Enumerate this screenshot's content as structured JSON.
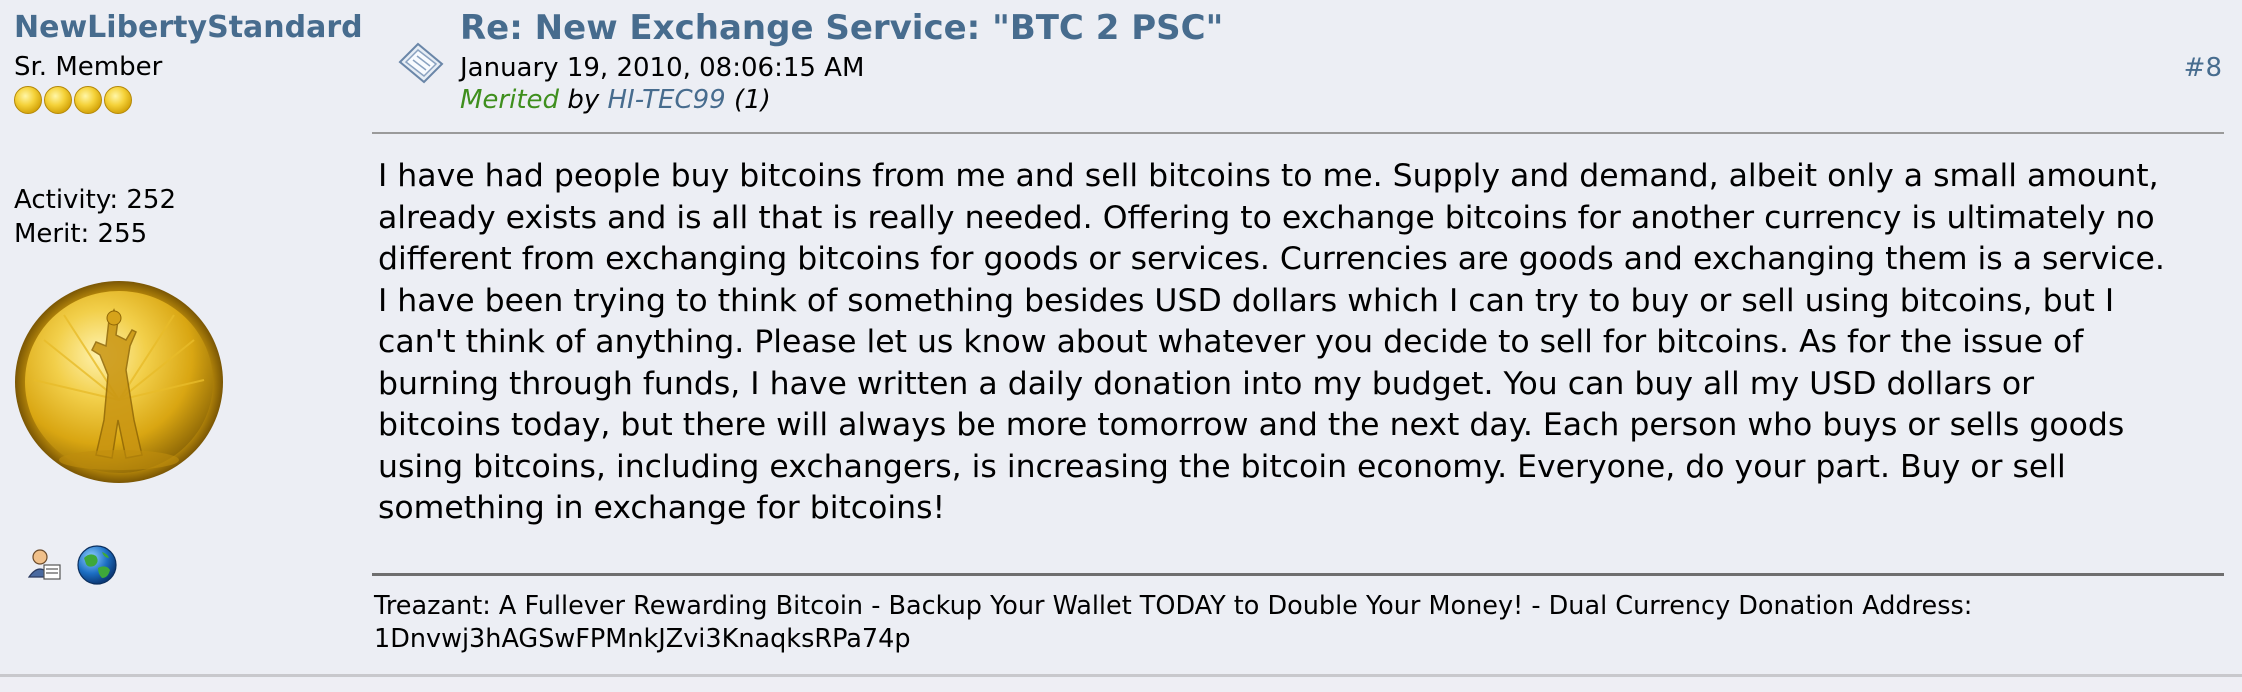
{
  "poster": {
    "name": "NewLibertyStandard",
    "rank": "Sr. Member",
    "star_count": 4,
    "activity": "Activity: 252",
    "merit": "Merit: 255",
    "avatar_icon": "gold-coin-lady-liberty",
    "profile_icons": [
      "profile-icon",
      "website-globe-icon"
    ]
  },
  "post": {
    "subject": "Re: New Exchange Service: \"BTC 2 PSC\"",
    "date": "January 19, 2010, 08:06:15 AM",
    "merited_word": "Merited",
    "merited_by": "by",
    "merited_user": "HI-TEC99",
    "merited_count": "(1)",
    "post_number": "#8",
    "body_lines": [
      "I have had people buy bitcoins from me and sell bitcoins to me. Supply and demand, albeit only a small amount,",
      "already exists and is all that is really needed. Offering to exchange bitcoins for another currency is ultimately no",
      "different from exchanging bitcoins for goods or services. Currencies are goods and exchanging them is a service.",
      "I have been trying to think of something besides USD dollars which I can try to buy or sell using bitcoins, but I",
      "can't think of anything. Please let us know about whatever you decide to sell for bitcoins. As for the issue of",
      "burning through funds, I have written a daily donation into my budget. You can buy all my USD dollars or",
      "bitcoins today, but there will always be more tomorrow and the next day. Each person who buys or sells goods",
      "using bitcoins, including exchangers, is increasing the bitcoin economy. Everyone, do your part. Buy or sell",
      "something in exchange for bitcoins!"
    ]
  },
  "signature": {
    "line1": "Treazant: A Fullever Rewarding Bitcoin - Backup Your Wallet TODAY to Double Your Money! - Dual Currency Donation Address:",
    "line2": "1Dnvwj3hAGSwFPMnkJZvi3KnaqksRPa74p"
  },
  "colors": {
    "link": "#476c8e",
    "merited_green": "#3f8f1e",
    "background": "#eceef4"
  }
}
